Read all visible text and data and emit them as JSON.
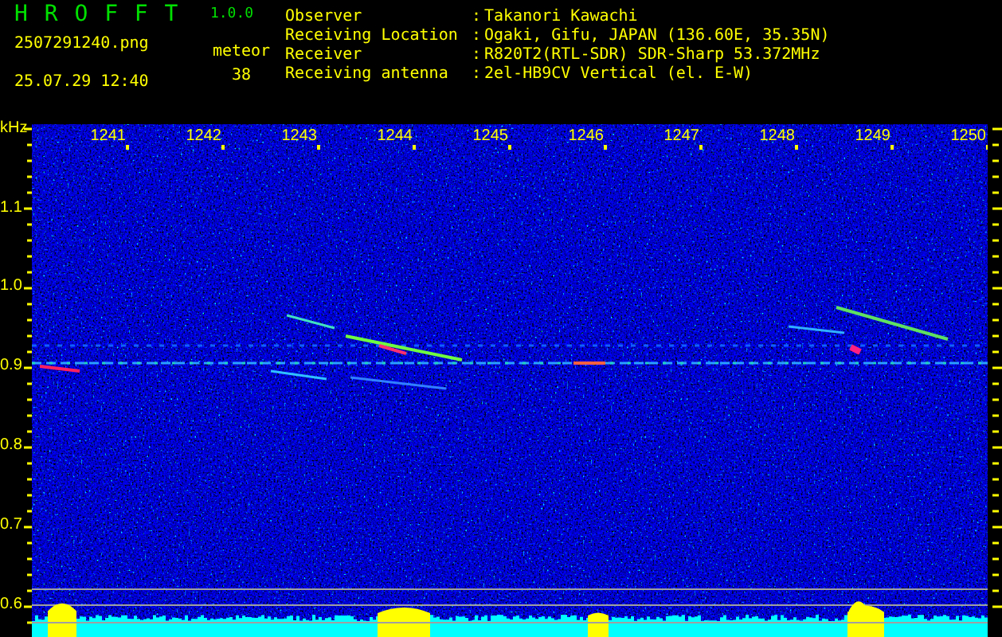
{
  "header": {
    "logo": "H R O F F T",
    "version": "1.0.0",
    "filename": "2507291240.png",
    "timestamp": "25.07.29 12:40",
    "meteor_label": "meteor",
    "meteor_count": "38"
  },
  "station_info": [
    {
      "label": "Observer",
      "separator": ":",
      "value": "Takanori Kawachi"
    },
    {
      "label": "Receiving Location",
      "separator": ":",
      "value": "Ogaki, Gifu, JAPAN (136.60E, 35.35N)"
    },
    {
      "label": "Receiver",
      "separator": ":",
      "value": "R820T2(RTL-SDR) SDR-Sharp 53.372MHz"
    },
    {
      "label": "Receiving antenna",
      "separator": ":",
      "value": "2el-HB9CV Vertical (el. E-W)"
    }
  ],
  "spectrogram": {
    "unit": "kHz",
    "time_labels": [
      "1241",
      "1242",
      "1243",
      "1244",
      "1245",
      "1246",
      "1247",
      "1248",
      "1249",
      "1250"
    ],
    "frequency_labels": [
      "1.1",
      "1.0",
      "0.9",
      "0.8",
      "0.7",
      "0.6"
    ]
  }
}
